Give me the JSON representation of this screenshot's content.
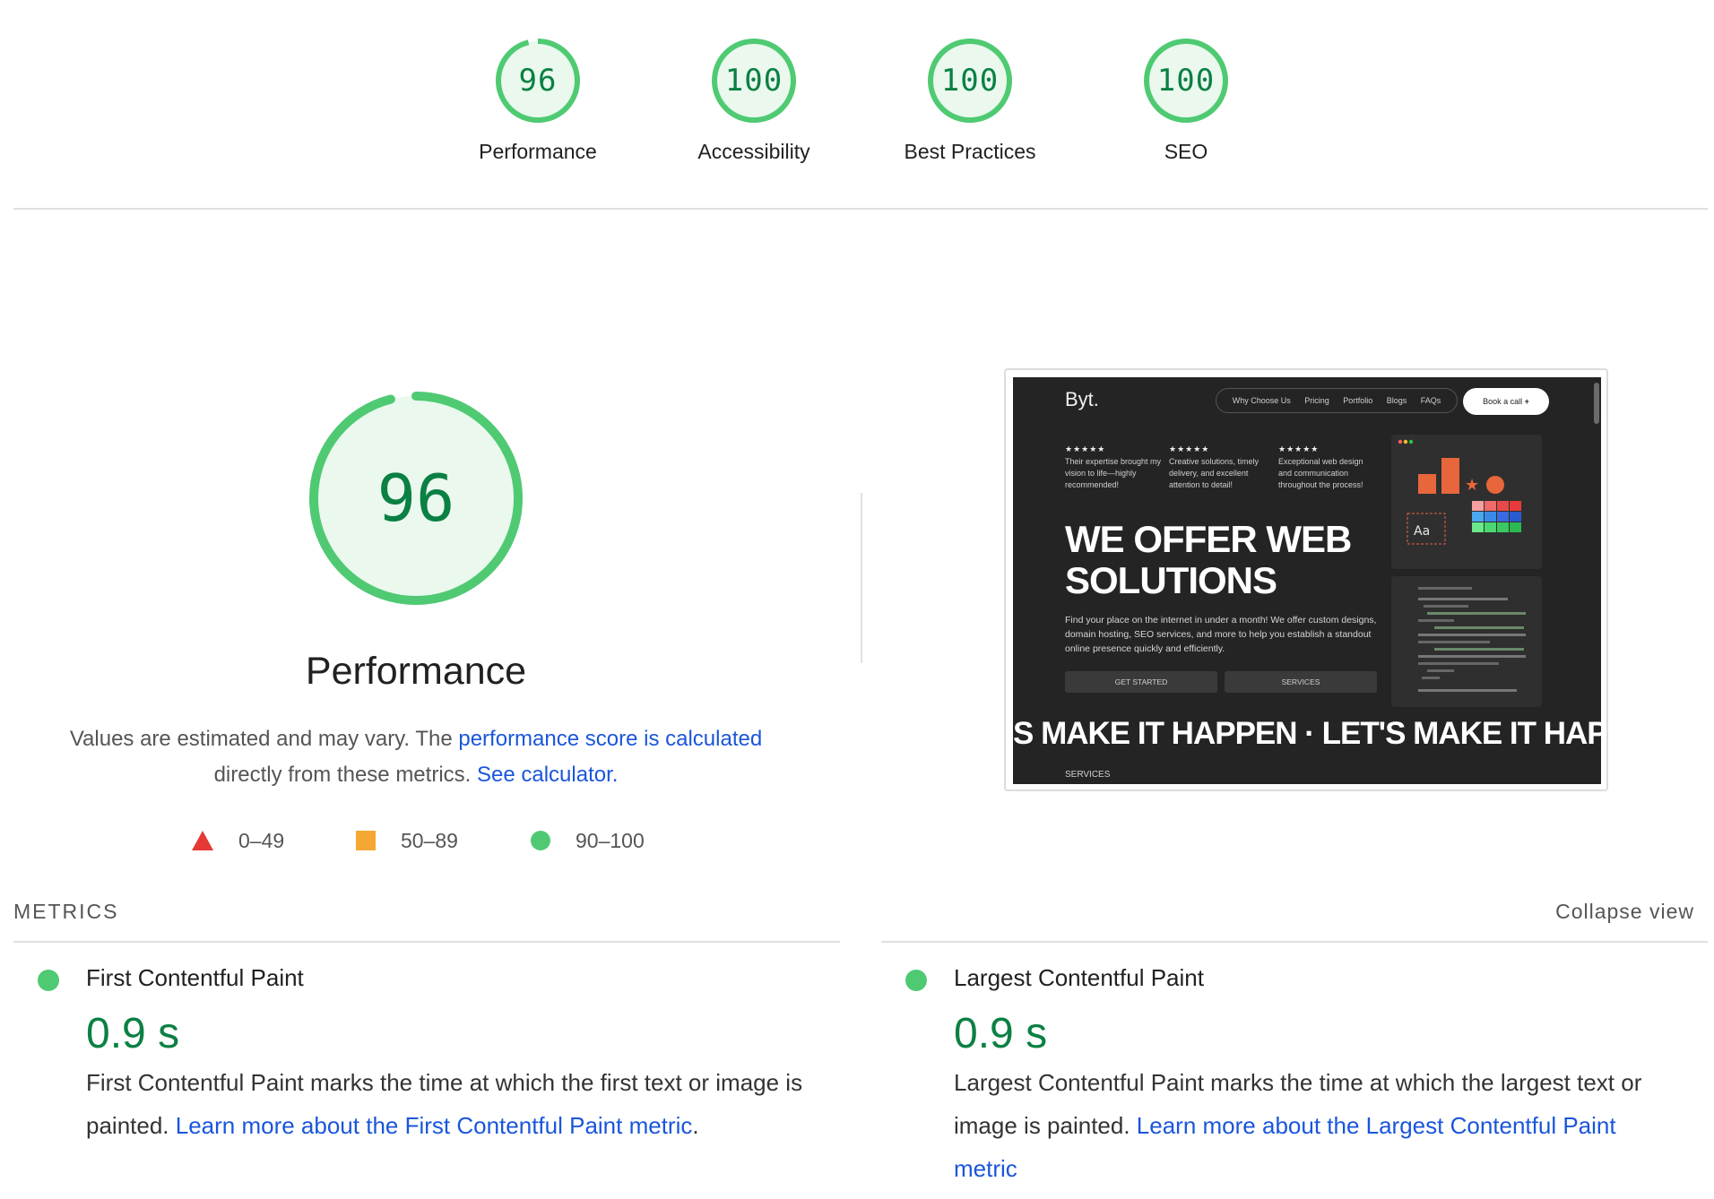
{
  "gauges": [
    {
      "score": "96",
      "label": "Performance"
    },
    {
      "score": "100",
      "label": "Accessibility"
    },
    {
      "score": "100",
      "label": "Best Practices"
    },
    {
      "score": "100",
      "label": "SEO"
    }
  ],
  "colors": {
    "pass": "#0b8043",
    "pass_ring": "#4fca72",
    "pass_fill": "#eaf8ee",
    "average": "#f4a833",
    "fail": "#e53935",
    "link": "#1a56db"
  },
  "performance": {
    "score": "96",
    "score_fraction": 0.96,
    "title": "Performance",
    "desc_pre": "Values are estimated and may vary. The ",
    "desc_link": "performance score is calculated",
    "desc_mid": " directly from these metrics. ",
    "desc_link2": "See calculator.",
    "legend": [
      {
        "icon": "triangle-icon",
        "range": "0–49"
      },
      {
        "icon": "square-icon",
        "range": "50–89"
      },
      {
        "icon": "circle-icon",
        "range": "90–100"
      }
    ]
  },
  "thumbnail": {
    "logo": "Byt.",
    "nav": [
      "Why Choose Us",
      "Pricing",
      "Portfolio",
      "Blogs",
      "FAQs"
    ],
    "cta": "Book a call",
    "reviews": [
      {
        "stars": "★★★★★",
        "text": "Their expertise brought my vision to life—highly recommended!"
      },
      {
        "stars": "★★★★★",
        "text": "Creative solutions, timely delivery, and excellent attention to detail!"
      },
      {
        "stars": "★★★★★",
        "text": "Exceptional web design and communication throughout the process!"
      }
    ],
    "headline_1": "WE OFFER WEB",
    "headline_2": "SOLUTIONS",
    "subtext": "Find your place on the internet in under a month! We offer custom designs, domain hosting, SEO services, and more to help you establish a standout online presence quickly and efficiently.",
    "btn_primary": "GET STARTED",
    "btn_secondary": "SERVICES",
    "marquee": "S MAKE IT HAPPEN  ·  LET'S MAKE IT HAPPEN",
    "section": "SERVICES",
    "card_label": "Aa"
  },
  "metrics": {
    "heading": "METRICS",
    "collapse": "Collapse view",
    "items": [
      {
        "title": "First Contentful Paint",
        "value": "0.9 s",
        "desc": "First Contentful Paint marks the time at which the first text or image is painted. ",
        "link": "Learn more about the First Contentful Paint metric",
        "after": "."
      },
      {
        "title": "Largest Contentful Paint",
        "value": "0.9 s",
        "desc": "Largest Contentful Paint marks the time at which the largest text or image is painted. ",
        "link": "Learn more about the Largest Contentful Paint metric",
        "after": ""
      }
    ]
  }
}
